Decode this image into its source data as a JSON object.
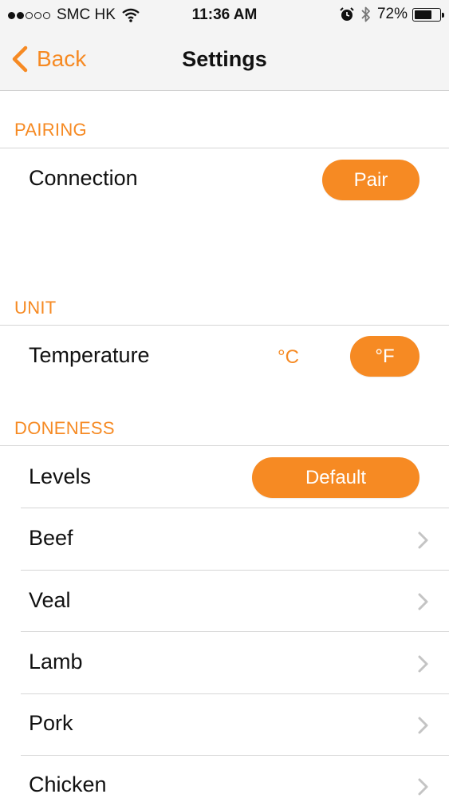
{
  "status_bar": {
    "carrier": "SMC HK",
    "time": "11:36 AM",
    "battery": "72%",
    "battery_level": 0.72
  },
  "nav": {
    "back_label": "Back",
    "title": "Settings"
  },
  "pairing": {
    "header": "PAIRING",
    "connection_label": "Connection",
    "pair_button": "Pair"
  },
  "unit": {
    "header": "UNIT",
    "temperature_label": "Temperature",
    "celsius": "°C",
    "fahrenheit": "°F",
    "selected": "°F"
  },
  "doneness": {
    "header": "DONENESS",
    "levels_label": "Levels",
    "levels_button": "Default",
    "items": [
      "Beef",
      "Veal",
      "Lamb",
      "Pork",
      "Chicken"
    ]
  },
  "colors": {
    "accent": "#f68a23",
    "bar_background": "#f4f4f4"
  }
}
